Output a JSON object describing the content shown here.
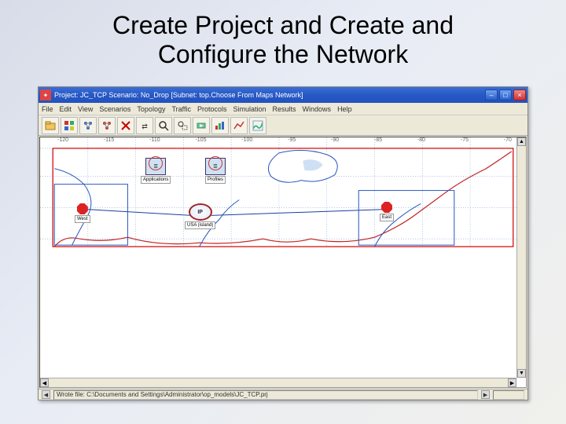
{
  "slide": {
    "title": "Create Project and Create and Configure the Network"
  },
  "window": {
    "title": "Project: JC_TCP Scenario: No_Drop  [Subnet: top.Choose From Maps Network]",
    "controls": {
      "minimize": "–",
      "maximize": "□",
      "close": "×"
    }
  },
  "menu": {
    "file": "File",
    "edit": "Edit",
    "view": "View",
    "scenarios": "Scenarios",
    "topology": "Topology",
    "traffic": "Traffic",
    "protocols": "Protocols",
    "simulation": "Simulation",
    "results": "Results",
    "windows": "Windows",
    "help": "Help"
  },
  "toolbar": {
    "icons": [
      "open-icon",
      "object-palette-icon",
      "deploy-app-icon",
      "deploy-server-icon",
      "failure-icon",
      "ace-icon",
      "zoom-icon",
      "zoom-rect-icon",
      "play-icon",
      "verify-icon",
      "results-icon",
      "report-icon"
    ]
  },
  "ruler": {
    "ticks": [
      "-120",
      "-115",
      "-110",
      "-105",
      "-100",
      "-95",
      "-90",
      "-85",
      "-80",
      "-75",
      "-70"
    ]
  },
  "nodes": {
    "applications": {
      "label": "Applications"
    },
    "profiles": {
      "label": "Profiles"
    },
    "west": {
      "label": "West"
    },
    "east": {
      "label": "East"
    },
    "ip": {
      "symbol": "IP",
      "label": "USA (island)"
    }
  },
  "status": {
    "text": "Wrote file: C:\\Documents and Settings\\Administrator\\op_models\\JC_TCP.prj"
  },
  "colors": {
    "titlebar": "#2758c4",
    "accent_red": "#c12222",
    "map_blue": "#2a57c0",
    "bg": "#ece9d8"
  }
}
